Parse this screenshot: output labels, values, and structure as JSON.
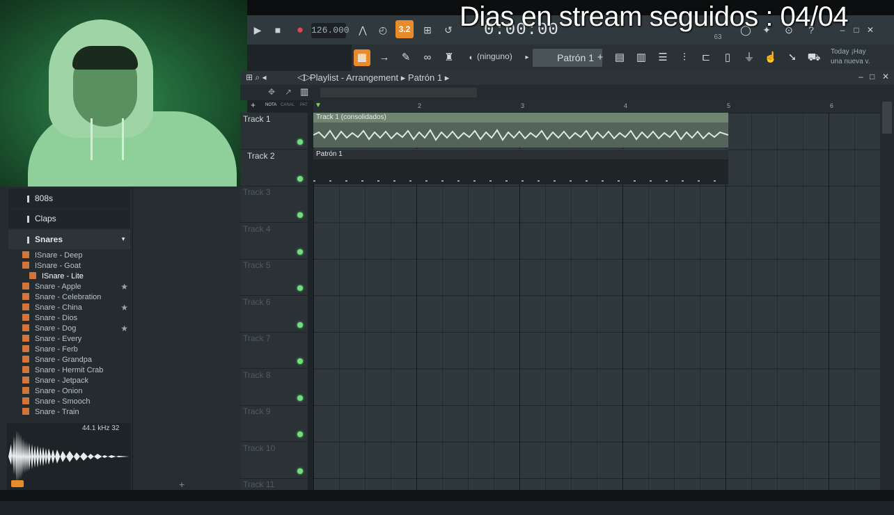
{
  "overlay": {
    "title": "Dias en stream seguidos : 04/04"
  },
  "transport": {
    "tempo": "126.000",
    "pattern_mode_label": "3.2",
    "time": "0:00:00",
    "cpu_value": "63"
  },
  "toolbar": {
    "channel_label": "(ninguno)",
    "pattern_label": "Patrón 1",
    "news_line1": "Today ¡Hay",
    "news_line2": "una nueva v."
  },
  "browser": {
    "folders": [
      {
        "label": "808s"
      },
      {
        "label": "Claps"
      },
      {
        "label": "Snares"
      }
    ],
    "files": [
      {
        "label": "ISnare - Deep",
        "star": ""
      },
      {
        "label": "ISnare - Goat",
        "star": ""
      },
      {
        "label": "ISnare - Lite",
        "star": ""
      },
      {
        "label": "Snare - Apple",
        "star": "★"
      },
      {
        "label": "Snare - Celebration",
        "star": ""
      },
      {
        "label": "Snare - China",
        "star": "★"
      },
      {
        "label": "Snare - Dios",
        "star": ""
      },
      {
        "label": "Snare - Dog",
        "star": "★"
      },
      {
        "label": "Snare - Every",
        "star": ""
      },
      {
        "label": "Snare - Ferb",
        "star": ""
      },
      {
        "label": "Snare - Grandpa",
        "star": ""
      },
      {
        "label": "Snare - Hermit Crab",
        "star": ""
      },
      {
        "label": "Snare - Jetpack",
        "star": ""
      },
      {
        "label": "Snare - Onion",
        "star": ""
      },
      {
        "label": "Snare - Smooch",
        "star": ""
      },
      {
        "label": "Snare - Train",
        "star": ""
      }
    ],
    "sample_info": "44.1 kHz 32"
  },
  "playlist": {
    "title": "Playlist - Arrangement",
    "breadcrumb": "Patrón 1",
    "tabs": [
      "NOTA",
      "CANAL",
      "PAT"
    ],
    "ruler": [
      "2",
      "3",
      "4",
      "5",
      "6"
    ],
    "tracks": [
      {
        "label": "Track 1"
      },
      {
        "label": "Track 2"
      },
      {
        "label": "Track 3"
      },
      {
        "label": "Track 4"
      },
      {
        "label": "Track 5"
      },
      {
        "label": "Track 6"
      },
      {
        "label": "Track 7"
      },
      {
        "label": "Track 8"
      },
      {
        "label": "Track 9"
      },
      {
        "label": "Track 10"
      },
      {
        "label": "Track 11"
      }
    ],
    "clips": {
      "audio": "Track 1 (consolidados)",
      "pattern": "Patrón 1"
    }
  },
  "colors": {
    "accent": "#e88b2a",
    "led": "#6fe07a",
    "audio_clip": "#54645a"
  }
}
